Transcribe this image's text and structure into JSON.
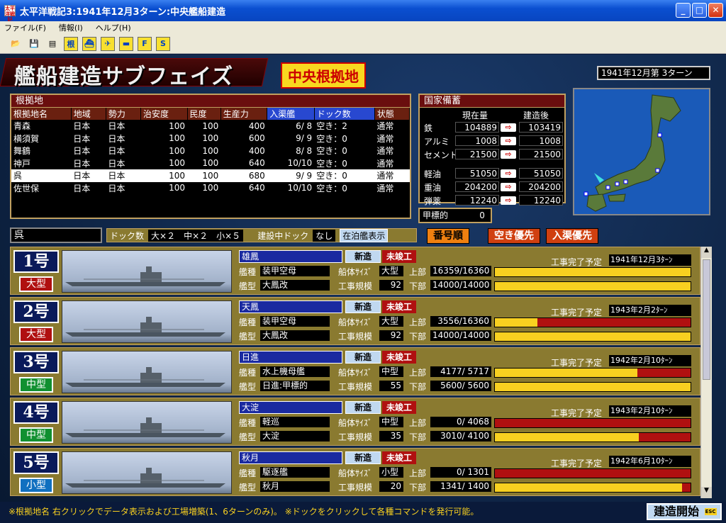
{
  "window": {
    "title": "太平洋戦記3:1941年12月3ターン:中央艦船建造",
    "app_icon": "太平洋戦記"
  },
  "menu": [
    "ファイル(F)",
    "情報(I)",
    "ヘルプ(H)"
  ],
  "toolbar": {
    "b1": "根",
    "b2": "F",
    "b3": "S"
  },
  "banner": "艦船建造サブフェイズ",
  "hq": "中央根拠地",
  "turn": "1941年12月第 3ターン",
  "base_panel": {
    "title": "根拠地",
    "headers": [
      "根拠地名",
      "地域",
      "勢力",
      "治安度",
      "民度",
      "生産力",
      "入渠艦",
      "ドック数",
      "状態"
    ],
    "rows": [
      [
        "青森",
        "日本",
        "日本",
        "100",
        "100",
        "400",
        "6/ 8",
        "空き：2",
        "通常"
      ],
      [
        "横須賀",
        "日本",
        "日本",
        "100",
        "100",
        "600",
        "9/ 9",
        "空き：0",
        "通常"
      ],
      [
        "舞鶴",
        "日本",
        "日本",
        "100",
        "100",
        "400",
        "8/ 8",
        "空き：0",
        "通常"
      ],
      [
        "神戸",
        "日本",
        "日本",
        "100",
        "100",
        "640",
        "10/10",
        "空き：0",
        "通常"
      ],
      [
        "呉",
        "日本",
        "日本",
        "100",
        "100",
        "680",
        "9/ 9",
        "空き：0",
        "通常"
      ],
      [
        "佐世保",
        "日本",
        "日本",
        "100",
        "100",
        "640",
        "10/10",
        "空き：0",
        "通常"
      ]
    ],
    "selected_index": 4
  },
  "reserve": {
    "title": "国家備蓄",
    "col_now": "現在量",
    "col_after": "建造後",
    "items": [
      {
        "label": "鉄",
        "now": "104889",
        "after": "103419"
      },
      {
        "label": "アルミ",
        "now": "1008",
        "after": "1008"
      },
      {
        "label": "セメント",
        "now": "21500",
        "after": "21500"
      },
      {
        "label": "軽油",
        "now": "51050",
        "after": "51050"
      },
      {
        "label": "重油",
        "now": "204200",
        "after": "204200"
      },
      {
        "label": "弾薬",
        "now": "12240",
        "after": "12240"
      }
    ]
  },
  "armor": {
    "label": "甲標的",
    "value": "0"
  },
  "selected_base": "呉",
  "dockbar": {
    "dock_label": "ドック数",
    "dock_value": "大×２　中×２　小×５",
    "building_label": "建設中ドック",
    "building_value": "なし",
    "berth_btn": "在泊艦表示"
  },
  "sort": {
    "by_number": "番号順",
    "empty_first": "空き優先",
    "docked_first": "入渠優先"
  },
  "slots": [
    {
      "num": "1号",
      "size": "大型",
      "size_color": "#b01010",
      "name": "雄鳳",
      "new": "新造",
      "state": "未竣工",
      "type": "装甲空母",
      "class": "大鳳改",
      "hull_label": "船体ｻｲｽﾞ",
      "hull": "大型",
      "scale_label": "工事規模",
      "scale": "92",
      "upper": "16359/16360",
      "lower": "14000/14000",
      "upper_pct": 0.9999,
      "lower_pct": 1.0,
      "due_label": "工事完了予定",
      "due": "1941年12月3ﾀｰﾝ",
      "k1": "艦種",
      "k2": "艦型",
      "u": "上部",
      "l": "下部"
    },
    {
      "num": "2号",
      "size": "大型",
      "size_color": "#b01010",
      "name": "天鳳",
      "new": "新造",
      "state": "未竣工",
      "type": "装甲空母",
      "class": "大鳳改",
      "hull_label": "船体ｻｲｽﾞ",
      "hull": "大型",
      "scale_label": "工事規模",
      "scale": "92",
      "upper": "3556/16360",
      "lower": "14000/14000",
      "upper_pct": 0.217,
      "lower_pct": 1.0,
      "due_label": "工事完了予定",
      "due": "1943年2月2ﾀｰﾝ",
      "k1": "艦種",
      "k2": "艦型",
      "u": "上部",
      "l": "下部"
    },
    {
      "num": "3号",
      "size": "中型",
      "size_color": "#109030",
      "name": "日進",
      "new": "新造",
      "state": "未竣工",
      "type": "水上機母艦",
      "class": "日進:甲標的",
      "hull_label": "船体ｻｲｽﾞ",
      "hull": "中型",
      "scale_label": "工事規模",
      "scale": "55",
      "upper": "4177/ 5717",
      "lower": "5600/ 5600",
      "upper_pct": 0.73,
      "lower_pct": 1.0,
      "due_label": "工事完了予定",
      "due": "1942年2月10ﾀｰﾝ",
      "k1": "艦種",
      "k2": "艦型",
      "u": "上部",
      "l": "下部"
    },
    {
      "num": "4号",
      "size": "中型",
      "size_color": "#109030",
      "name": "大淀",
      "new": "新造",
      "state": "未竣工",
      "type": "軽巡",
      "class": "大淀",
      "hull_label": "船体ｻｲｽﾞ",
      "hull": "中型",
      "scale_label": "工事規模",
      "scale": "35",
      "upper": "0/ 4068",
      "lower": "3010/ 4100",
      "upper_pct": 0.0,
      "lower_pct": 0.734,
      "due_label": "工事完了予定",
      "due": "1943年2月10ﾀｰﾝ",
      "k1": "艦種",
      "k2": "艦型",
      "u": "上部",
      "l": "下部"
    },
    {
      "num": "5号",
      "size": "小型",
      "size_color": "#1070c0",
      "name": "秋月",
      "new": "新造",
      "state": "未竣工",
      "type": "駆逐艦",
      "class": "秋月",
      "hull_label": "船体ｻｲｽﾞ",
      "hull": "小型",
      "scale_label": "工事規模",
      "scale": "20",
      "upper": "0/ 1301",
      "lower": "1341/ 1400",
      "upper_pct": 0.0,
      "lower_pct": 0.958,
      "due_label": "工事完了予定",
      "due": "1942年6月10ﾀｰﾝ",
      "k1": "艦種",
      "k2": "艦型",
      "u": "上部",
      "l": "下部"
    }
  ],
  "footer": "※根拠地名 右クリックでデータ表示および工場増築(1、6ターンのみ)。 ※ドックをクリックして各種コマンドを発行可能。",
  "start_button": "建造開始",
  "start_badge": "ESC"
}
